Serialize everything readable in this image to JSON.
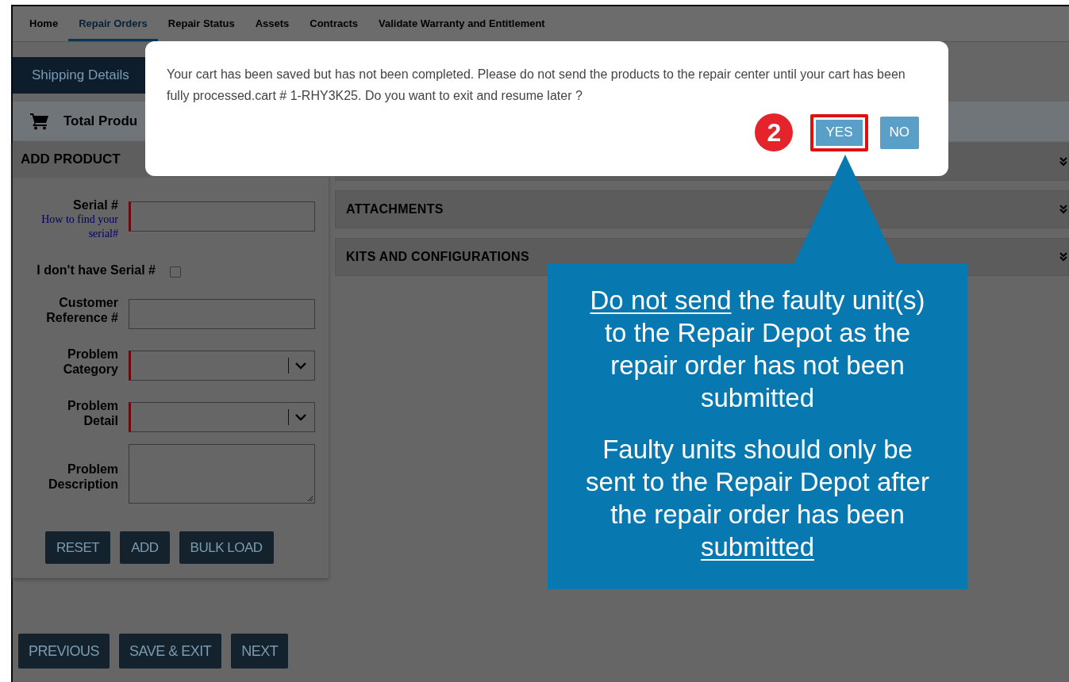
{
  "nav": {
    "tabs": [
      {
        "label": "Home",
        "selected": false
      },
      {
        "label": "Repair Orders",
        "selected": true
      },
      {
        "label": "Repair Status",
        "selected": false
      },
      {
        "label": "Assets",
        "selected": false
      },
      {
        "label": "Contracts",
        "selected": false
      },
      {
        "label": "Validate Warranty and Entitlement",
        "selected": false
      }
    ]
  },
  "step_tab": "Shipping Details",
  "summary": "Total Produ",
  "add_product": {
    "title": "ADD PRODUCT",
    "fields": [
      {
        "kind": "text",
        "label": "Serial #",
        "link": "How to find your serial#",
        "required": true
      },
      {
        "kind": "checkbox",
        "label": "I don't have Serial #",
        "checked": false
      },
      {
        "kind": "text",
        "label": "Customer Reference #",
        "required": false
      },
      {
        "kind": "select",
        "label": "Problem Category",
        "required": true
      },
      {
        "kind": "select",
        "label": "Problem Detail",
        "required": true
      },
      {
        "kind": "textarea",
        "label": "Problem Description",
        "required": false
      }
    ],
    "buttons": [
      "RESET",
      "ADD",
      "BULK LOAD"
    ]
  },
  "sections": [
    {
      "kind": "covered"
    },
    {
      "kind": "titled",
      "title": "ATTACHMENTS"
    },
    {
      "kind": "titled",
      "title": "KITS AND CONFIGURATIONS"
    }
  ],
  "footer_buttons": [
    "PREVIOUS",
    "SAVE & EXIT",
    "NEXT"
  ],
  "dialog": {
    "message": "Your cart has been saved but has not been completed. Please do not send the products to the repair center until your cart has been fully processed.cart # 1-RHY3K25. Do you want to exit and resume later ?",
    "step": "2",
    "buttons": [
      {
        "label": "YES",
        "highlighted": true
      },
      {
        "label": "NO",
        "highlighted": false
      }
    ]
  },
  "callout": {
    "paragraphs": [
      [
        {
          "text": "Do not send",
          "underlined": true
        },
        {
          "text": " the faulty unit(s) to the Repair Depot as the repair order has not been submitted",
          "underlined": false
        }
      ],
      [
        {
          "text": "Faulty units should only be sent to the Repair Depot after the repair order has been ",
          "underlined": false
        },
        {
          "text": "submitted",
          "underlined": true
        }
      ]
    ]
  }
}
